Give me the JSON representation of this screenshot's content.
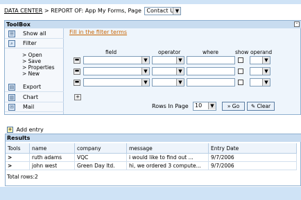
{
  "breadcrumb": {
    "link": "DATA CENTER",
    "separator": ">",
    "text": "REPORT OF: App My Forms, Page",
    "page_select_value": "Contact Us"
  },
  "toolbox": {
    "title": "ToolBox",
    "minimize": "-",
    "sidebar": {
      "show_all": "Show all",
      "filter": "Filter",
      "sub_items": [
        "> Open",
        "> Save",
        "> Properties",
        "> New"
      ],
      "export": "Export",
      "chart": "Chart",
      "mail": "Mail"
    },
    "filter_link": "Fill in the filter terms",
    "headers": {
      "field": "field",
      "operator": "operator",
      "where": "where",
      "show": "show",
      "operand": "operand"
    },
    "rows_label": "Rows In Page",
    "rows_value": "10",
    "go_label": "» Go",
    "clear_label": "Clear"
  },
  "add_entry": "Add entry",
  "results": {
    "title": "Results",
    "columns": [
      "Tools",
      "name",
      "company",
      "message",
      "Entry Date"
    ],
    "rows": [
      {
        "tool": ">",
        "name": "ruth adams",
        "company": "VQC",
        "message": "i would like to find out ...",
        "date": "9/7/2006"
      },
      {
        "tool": ">",
        "name": "john west",
        "company": "Green Day ltd.",
        "message": "hi, we ordered 3 compute...",
        "date": "9/7/2006"
      }
    ],
    "total": "Total rows:2"
  }
}
